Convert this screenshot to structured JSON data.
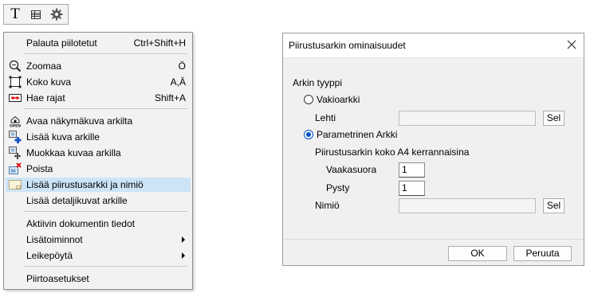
{
  "toolbar": {
    "text_tool_label": "T",
    "icons": [
      "text-tool-icon",
      "table-icon",
      "gear-icon"
    ]
  },
  "menu": {
    "items": [
      {
        "label": "Palauta piilotetut",
        "shortcut": "Ctrl+Shift+H",
        "icon": ""
      },
      {
        "label": "Zoomaa",
        "shortcut": "Ö",
        "icon": "zoom-icon"
      },
      {
        "label": "Koko kuva",
        "shortcut": "A,Ä",
        "icon": "fit-view-icon"
      },
      {
        "label": "Hae rajat",
        "shortcut": "Shift+A",
        "icon": "bounds-icon"
      },
      {
        "label": "Avaa näkymäkuva arkilta",
        "shortcut": "",
        "icon": "open-view-icon"
      },
      {
        "label": "Lisää kuva arkille",
        "shortcut": "",
        "icon": "add-image-icon"
      },
      {
        "label": "Muokkaa kuvaa arkilla",
        "shortcut": "",
        "icon": "edit-image-icon"
      },
      {
        "label": "Poista",
        "shortcut": "",
        "icon": "delete-image-icon"
      },
      {
        "label": "Lisää piirustusarkki ja nimiö",
        "shortcut": "",
        "icon": "add-sheet-icon"
      },
      {
        "label": "Lisää detaljikuvat arkille",
        "shortcut": "",
        "icon": ""
      },
      {
        "label": "Aktiivin dokumentin tiedot",
        "shortcut": "",
        "icon": ""
      },
      {
        "label": "Lisätoiminnot",
        "shortcut": "",
        "icon": "",
        "submenu": true
      },
      {
        "label": "Leikepöytä",
        "shortcut": "",
        "icon": "",
        "submenu": true
      },
      {
        "label": "Piirtoasetukset",
        "shortcut": "",
        "icon": ""
      }
    ],
    "highlighted_index": 8,
    "highlight_color": "#cce4f7"
  },
  "dialog": {
    "title": "Piirustusarkin ominaisuudet",
    "sheet_type_label": "Arkin tyyppi",
    "standard_option": "Vakioarkki",
    "sheet_label": "Lehti",
    "sheet_value": "",
    "select_label": "Sel",
    "parametric_option": "Parametrinen Arkki",
    "size_label": "Piirustusarkin koko A4 kerrannaisina",
    "horizontal_label": "Vaakasuora",
    "horizontal_value": "1",
    "vertical_label": "Pysty",
    "vertical_value": "1",
    "title_block_label": "Nimiö",
    "title_block_value": "",
    "ok_label": "OK",
    "cancel_label": "Peruuta",
    "selected_option": "parametric",
    "accent_color": "#0050c8"
  }
}
